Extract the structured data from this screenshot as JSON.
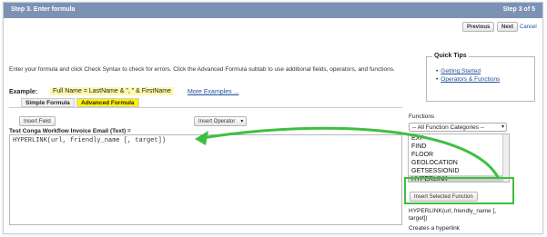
{
  "header": {
    "title": "Step 3. Enter formula",
    "step_label": "Step 3 of 5"
  },
  "nav": {
    "previous": "Previous",
    "next": "Next",
    "cancel": "Cancel"
  },
  "instructions": "Enter your formula and click Check Syntax to check for errors. Click the Advanced Formula subtab to use additional fields, operators, and functions.",
  "example": {
    "label": "Example:",
    "value": "Full Name = LastName & \", \" & FirstName",
    "more_link": "More Examples ..."
  },
  "tabs": [
    {
      "label": "Simple Formula"
    },
    {
      "label": "Advanced Formula"
    }
  ],
  "quick_tips": {
    "title": "Quick Tips",
    "items": [
      "Getting Started",
      "Operators & Functions"
    ]
  },
  "toolbar": {
    "insert_field": "Insert Field",
    "insert_operator": "Insert Operator"
  },
  "editor": {
    "field_label": "Test Conga Workflow Invoice Email (Text) =",
    "value": "HYPERLINK(url, friendly_name [, target])"
  },
  "functions": {
    "label": "Functions",
    "category_select": "-- All Function Categories --",
    "items": [
      "EXP",
      "FIND",
      "FLOOR",
      "GEOLOCATION",
      "GETSESSIONID",
      "HYPERLINK"
    ],
    "selected": "HYPERLINK",
    "insert_button": "Insert Selected Function",
    "signature": "HYPERLINK(url, friendly_name [, target])",
    "description": "Creates a hyperlink"
  },
  "colors": {
    "header_bg": "#7b92b4",
    "highlight_green": "#3fbf3f",
    "arrow_green": "#3fbf3f",
    "example_highlight": "#fff8b0",
    "tab_active": "#fff200"
  }
}
